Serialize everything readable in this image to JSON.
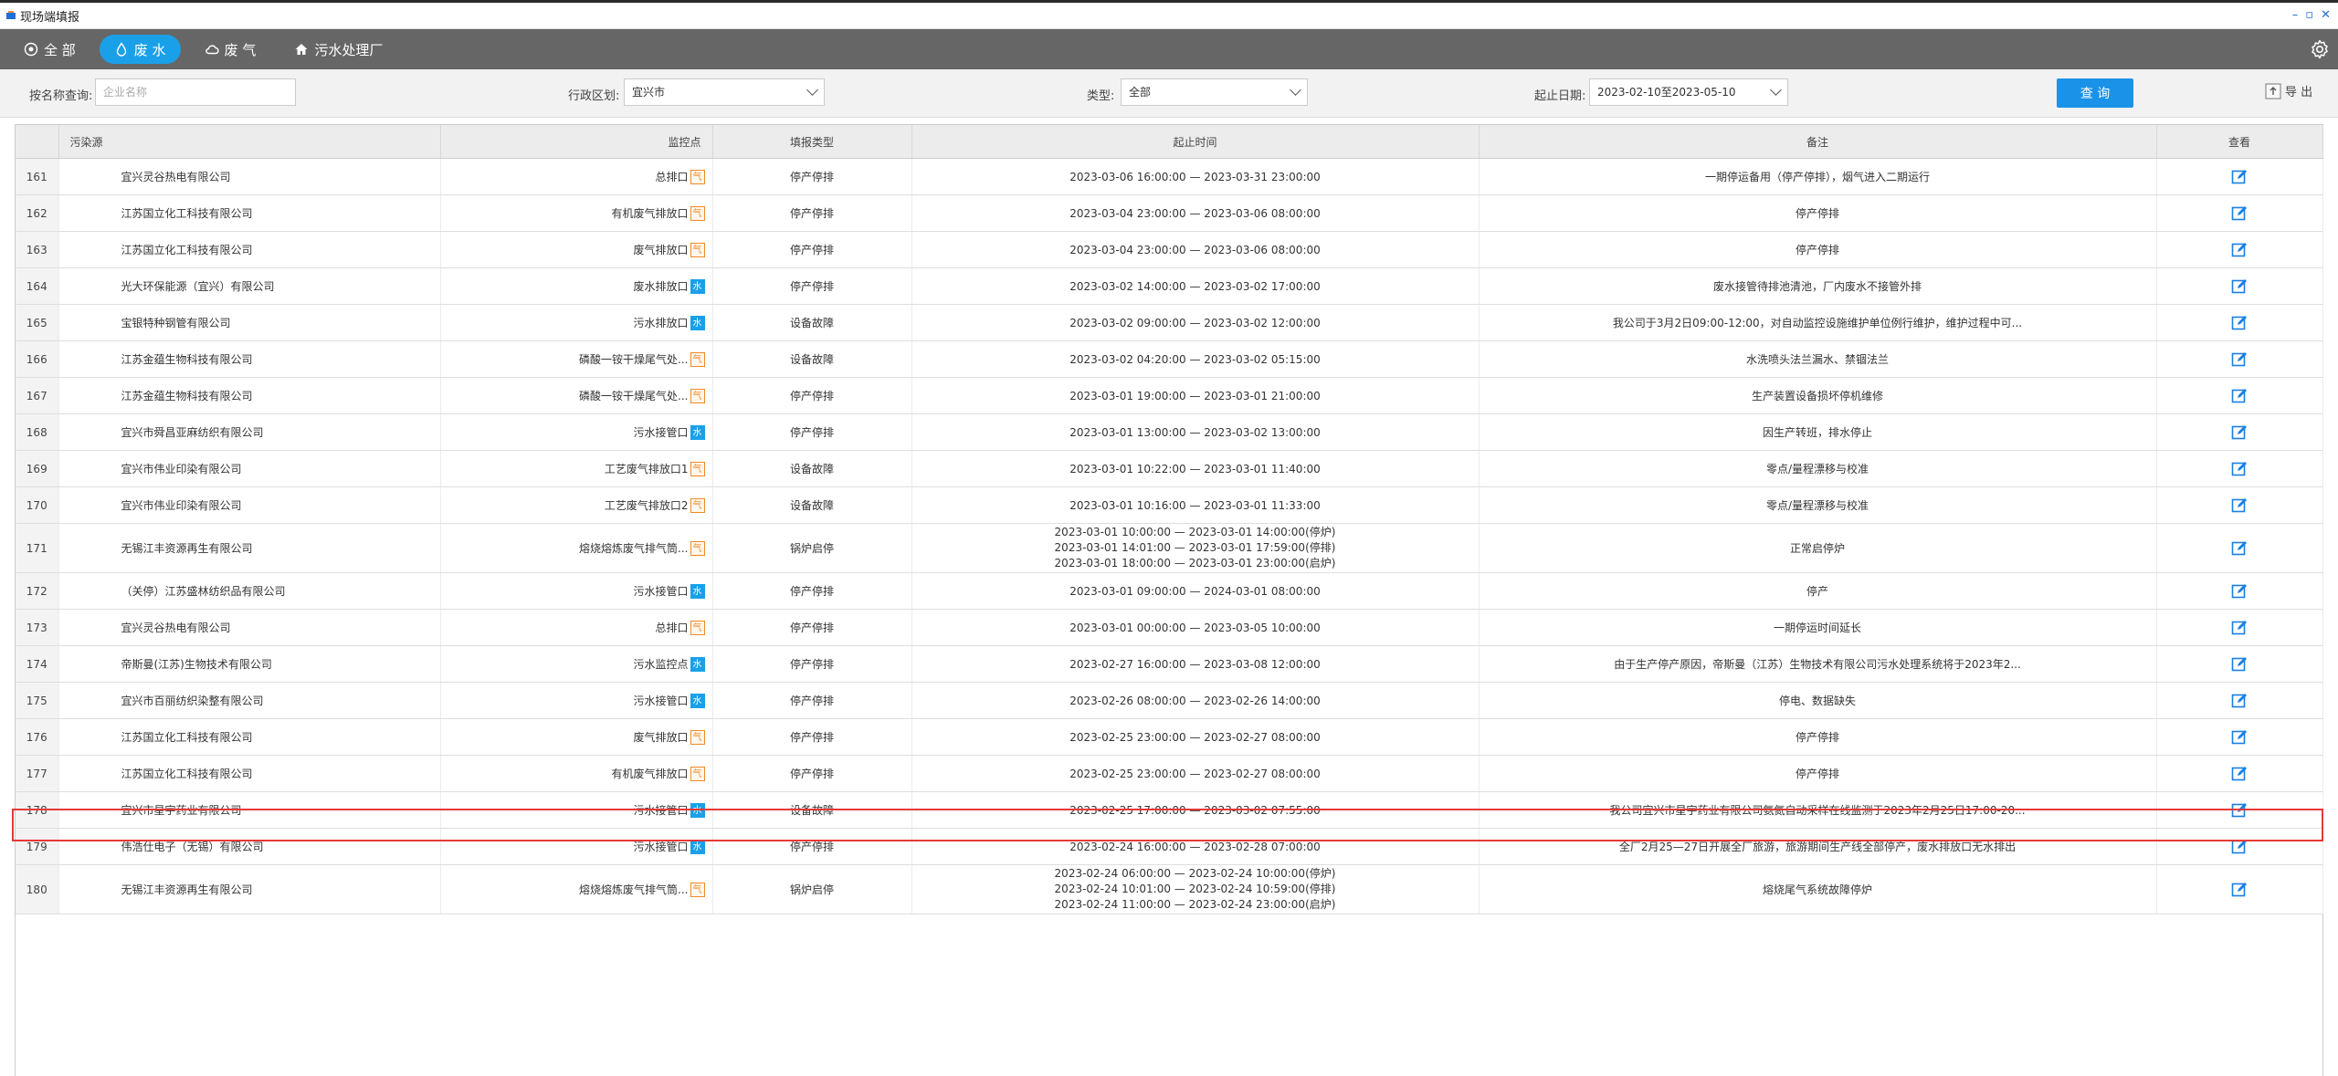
{
  "window": {
    "title": "现场端填报",
    "controls": [
      "–",
      "▫",
      "✕"
    ]
  },
  "nav": {
    "items": [
      {
        "label": "全 部",
        "icon": "target-icon"
      },
      {
        "label": "废 水",
        "icon": "water-drop-icon",
        "active": true
      },
      {
        "label": "废 气",
        "icon": "cloud-icon"
      },
      {
        "label": "污水处理厂",
        "icon": "house-icon"
      }
    ]
  },
  "filters": {
    "name_label": "按名称查询:",
    "name_placeholder": "企业名称",
    "region_label": "行政区划:",
    "region_value": "宜兴市",
    "type_label": "类型:",
    "type_value": "全部",
    "date_label": "起止日期:",
    "date_value": "2023-02-10至2023-05-10",
    "query_label": "查 询",
    "export_label": "导 出"
  },
  "table": {
    "columns": [
      "",
      "污染源",
      "监控点",
      "填报类型",
      "起止时间",
      "备注",
      "查看"
    ],
    "rows": [
      {
        "n": "161",
        "src": "宜兴灵谷热电有限公司",
        "pt": "总排口",
        "tag": "气",
        "type": "停产停排",
        "time": [
          "2023-03-06 16:00:00 — 2023-03-31 23:00:00"
        ],
        "note": "一期停运备用（停产停排），烟气进入二期运行"
      },
      {
        "n": "162",
        "src": "江苏国立化工科技有限公司",
        "pt": "有机废气排放口",
        "tag": "气",
        "type": "停产停排",
        "time": [
          "2023-03-04 23:00:00 — 2023-03-06 08:00:00"
        ],
        "note": "停产停排"
      },
      {
        "n": "163",
        "src": "江苏国立化工科技有限公司",
        "pt": "废气排放口",
        "tag": "气",
        "type": "停产停排",
        "time": [
          "2023-03-04 23:00:00 — 2023-03-06 08:00:00"
        ],
        "note": "停产停排"
      },
      {
        "n": "164",
        "src": "光大环保能源（宜兴）有限公司",
        "pt": "废水排放口",
        "tag": "水",
        "type": "停产停排",
        "time": [
          "2023-03-02 14:00:00 — 2023-03-02 17:00:00"
        ],
        "note": "废水接管待排池清池，厂内废水不接管外排"
      },
      {
        "n": "165",
        "src": "宝银特种钢管有限公司",
        "pt": "污水排放口",
        "tag": "水",
        "type": "设备故障",
        "time": [
          "2023-03-02 09:00:00 — 2023-03-02 12:00:00"
        ],
        "note": "我公司于3月2日09:00-12:00，对自动监控设施维护单位例行维护，维护过程中可..."
      },
      {
        "n": "166",
        "src": "江苏金蕴生物科技有限公司",
        "pt": "磷酸一铵干燥尾气处...",
        "tag": "气",
        "type": "设备故障",
        "time": [
          "2023-03-02 04:20:00 — 2023-03-02 05:15:00"
        ],
        "note": "水洗喷头法兰漏水、禁锢法兰"
      },
      {
        "n": "167",
        "src": "江苏金蕴生物科技有限公司",
        "pt": "磷酸一铵干燥尾气处...",
        "tag": "气",
        "type": "停产停排",
        "time": [
          "2023-03-01 19:00:00 — 2023-03-01 21:00:00"
        ],
        "note": "生产装置设备损坏停机维修"
      },
      {
        "n": "168",
        "src": "宜兴市舜昌亚麻纺织有限公司",
        "pt": "污水接管口",
        "tag": "水",
        "type": "停产停排",
        "time": [
          "2023-03-01 13:00:00 — 2023-03-02 13:00:00"
        ],
        "note": "因生产转班，排水停止"
      },
      {
        "n": "169",
        "src": "宜兴市伟业印染有限公司",
        "pt": "工艺废气排放口1",
        "tag": "气",
        "type": "设备故障",
        "time": [
          "2023-03-01 10:22:00 — 2023-03-01 11:40:00"
        ],
        "note": "零点/量程漂移与校准"
      },
      {
        "n": "170",
        "src": "宜兴市伟业印染有限公司",
        "pt": "工艺废气排放口2",
        "tag": "气",
        "type": "设备故障",
        "time": [
          "2023-03-01 10:16:00 — 2023-03-01 11:33:00"
        ],
        "note": "零点/量程漂移与校准"
      },
      {
        "n": "171",
        "src": "无锡江丰资源再生有限公司",
        "pt": "熔烧熔炼废气排气筒...",
        "tag": "气",
        "type": "锅炉启停",
        "time": [
          "2023-03-01 10:00:00 — 2023-03-01 14:00:00(停炉)",
          "2023-03-01 14:01:00 — 2023-03-01 17:59:00(停排)",
          "2023-03-01 18:00:00 — 2023-03-01 23:00:00(启炉)"
        ],
        "note": "正常启停炉"
      },
      {
        "n": "172",
        "src": "（关停）江苏盛林纺织品有限公司",
        "pt": "污水接管口",
        "tag": "水",
        "type": "停产停排",
        "time": [
          "2023-03-01 09:00:00 — 2024-03-01 08:00:00"
        ],
        "note": "停产"
      },
      {
        "n": "173",
        "src": "宜兴灵谷热电有限公司",
        "pt": "总排口",
        "tag": "气",
        "type": "停产停排",
        "time": [
          "2023-03-01 00:00:00 — 2023-03-05 10:00:00"
        ],
        "note": "一期停运时间延长"
      },
      {
        "n": "174",
        "src": "帝斯曼(江苏)生物技术有限公司",
        "pt": "污水监控点",
        "tag": "水",
        "type": "停产停排",
        "time": [
          "2023-02-27 16:00:00 — 2023-03-08 12:00:00"
        ],
        "note": "由于生产停产原因，帝斯曼（江苏）生物技术有限公司污水处理系统将于2023年2..."
      },
      {
        "n": "175",
        "src": "宜兴市百丽纺织染整有限公司",
        "pt": "污水接管口",
        "tag": "水",
        "type": "停产停排",
        "time": [
          "2023-02-26 08:00:00 — 2023-02-26 14:00:00"
        ],
        "note": "停电、数据缺失"
      },
      {
        "n": "176",
        "src": "江苏国立化工科技有限公司",
        "pt": "废气排放口",
        "tag": "气",
        "type": "停产停排",
        "time": [
          "2023-02-25 23:00:00 — 2023-02-27 08:00:00"
        ],
        "note": "停产停排"
      },
      {
        "n": "177",
        "src": "江苏国立化工科技有限公司",
        "pt": "有机废气排放口",
        "tag": "气",
        "type": "停产停排",
        "time": [
          "2023-02-25 23:00:00 — 2023-02-27 08:00:00"
        ],
        "note": "停产停排"
      },
      {
        "n": "178",
        "src": "宜兴市星宇药业有限公司",
        "pt": "污水接管口",
        "tag": "水",
        "type": "设备故障",
        "time": [
          "2023-02-25 17:00:00 — 2023-03-02 07:55:00"
        ],
        "note": "我公司宜兴市星宇药业有限公司氨氮自动采样在线监测于2023年2月25日17:00-20..."
      },
      {
        "n": "179",
        "src": "伟浩仕电子（无锡）有限公司",
        "pt": "污水接管口",
        "tag": "水",
        "type": "停产停排",
        "time": [
          "2023-02-24 16:00:00 — 2023-02-28 07:00:00"
        ],
        "note": "全厂2月25—27日开展全厂旅游，旅游期间生产线全部停产，废水排放口无水排出"
      },
      {
        "n": "180",
        "src": "无锡江丰资源再生有限公司",
        "pt": "熔烧熔炼废气排气筒...",
        "tag": "气",
        "type": "锅炉启停",
        "time": [
          "2023-02-24 06:00:00 — 2023-02-24 10:00:00(停炉)",
          "2023-02-24 10:01:00 — 2023-02-24 10:59:00(停排)",
          "2023-02-24 11:00:00 — 2023-02-24 23:00:00(启炉)"
        ],
        "note": "熔烧尾气系统故障停炉"
      }
    ],
    "selected_row": "178"
  },
  "colors": {
    "accent": "#1aa0e8",
    "nav_bg": "#666666",
    "gas_tag": "#f08a24",
    "water_tag": "#1aa0e8",
    "selection": "#e53935"
  }
}
